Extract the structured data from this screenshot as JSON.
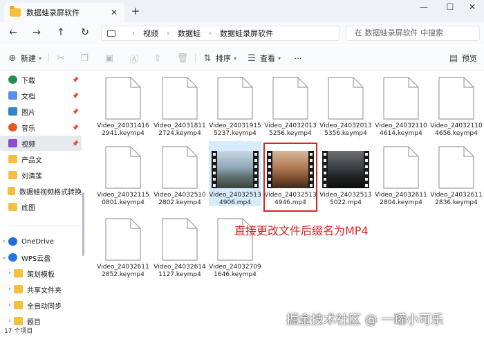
{
  "window": {
    "tab_title": "数据蛙录屏软件",
    "new_tab": "+",
    "close_tab": "✕",
    "minimize": "—",
    "maximize": "☐",
    "close": "✕"
  },
  "nav": {
    "back": "←",
    "forward": "→",
    "up": "↑",
    "refresh": "↻",
    "breadcrumb": [
      "视频",
      "数据蛙",
      "数据蛙录屏软件"
    ],
    "search_placeholder": "在 数据蛙录屏软件 中搜索"
  },
  "toolbar": {
    "new_label": "新建",
    "sort_label": "排序",
    "view_label": "查看",
    "more": "···",
    "preview_label": "预览"
  },
  "sidebar": {
    "pinned": [
      {
        "label": "下载",
        "icon": "download-icon"
      },
      {
        "label": "文档",
        "icon": "document-icon"
      },
      {
        "label": "图片",
        "icon": "pictures-icon"
      },
      {
        "label": "音乐",
        "icon": "music-icon"
      },
      {
        "label": "视频",
        "icon": "videos-icon"
      },
      {
        "label": "产品文",
        "icon": "folder-icon"
      },
      {
        "label": "刘清莲",
        "icon": "folder-icon"
      },
      {
        "label": "数据蛙视频格式转换",
        "icon": "folder-icon"
      },
      {
        "label": "底图",
        "icon": "folder-icon"
      }
    ],
    "onedrive": "OneDrive",
    "wps": "WPS云盘",
    "wps_children": [
      "策划模板",
      "共享文件夹",
      "全自动同步",
      "题目"
    ]
  },
  "files": [
    {
      "name": "Video_240314162941.keymp4",
      "type": "doc"
    },
    {
      "name": "Video_240318112724.keymp4",
      "type": "doc"
    },
    {
      "name": "Video_240319155237.keymp4",
      "type": "doc"
    },
    {
      "name": "Video_240320135256.keymp4",
      "type": "doc"
    },
    {
      "name": "Video_240320135356.keymp4",
      "type": "doc"
    },
    {
      "name": "Video_240321104614.keymp4",
      "type": "doc"
    },
    {
      "name": "Video_240321104656.keymp4",
      "type": "doc"
    },
    {
      "name": "Video_240321150801.keymp4",
      "type": "doc"
    },
    {
      "name": "Video_240325102802.keymp4",
      "type": "doc"
    },
    {
      "name": "Video_240325134906.mp4",
      "type": "video"
    },
    {
      "name": "Video_240325134946.mp4",
      "type": "video"
    },
    {
      "name": "Video_240325135022.mp4",
      "type": "video"
    },
    {
      "name": "Video_240326112804.keymp4",
      "type": "doc"
    },
    {
      "name": "Video_240326112836.keymp4",
      "type": "doc"
    },
    {
      "name": "Video_240326112852.keymp4",
      "type": "doc"
    },
    {
      "name": "Video_240326141127.keymp4",
      "type": "doc"
    },
    {
      "name": "Video_240327091646.keymp4",
      "type": "doc"
    }
  ],
  "annotation": "直接更改文件后缀名为MP4",
  "status": "17 个项目",
  "watermark": "掘金技术社区 @ 一罐小可乐",
  "colors": {
    "accent": "#e02020",
    "selected": "#d6ebfb",
    "folder": "#f4c03e"
  }
}
